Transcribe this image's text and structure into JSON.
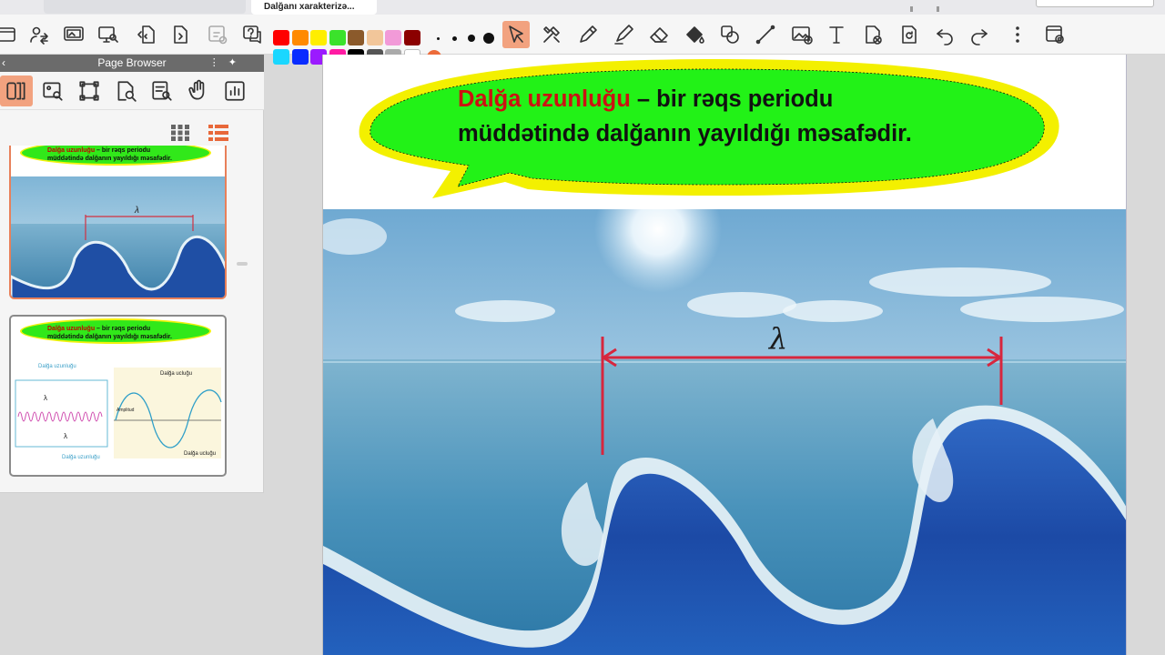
{
  "tabs": {
    "active_label": "Dalğanı xarakterizə..."
  },
  "toolbar": {
    "colors": {
      "row1": [
        "#ff0000",
        "#ff8a00",
        "#ffee00",
        "#3be22b",
        "#8b5a2b",
        "#f2c69a",
        "#f29ad8",
        "#8b0000"
      ],
      "row2": [
        "#1ad7ff",
        "#0a2cff",
        "#9b1aff",
        "#ff1aa3",
        "#000000",
        "#555555",
        "#aaaaaa",
        "#ffffff"
      ]
    },
    "selected_tool": "select-arrow"
  },
  "page_browser": {
    "title": "Page Browser",
    "view_modes": [
      "grid-view-icon",
      "list-view-icon"
    ],
    "selected_view": "list-view-icon",
    "thumbnails": [
      {
        "heading_term": "Dalğa uzunluğu",
        "heading_rest": " – bir rəqs periodu",
        "line2": "müddətində dalğanın yayıldığı məsafədir.",
        "lambda": "λ"
      },
      {
        "heading_term": "Dalğa uzunluğu",
        "heading_rest": " – bir rəqs periodu",
        "line2": "müddətində dalğanın yayıldığı məsafədir.",
        "diagram_labels": {
          "top_left": "Dalğa uzunluğu",
          "lambda_a": "λ",
          "lambda_b": "λ",
          "bottom_left": "Dalğa uzunluğu",
          "top_right": "Dalğa ucluğu",
          "amplitude": "Amplitud",
          "bottom_right": "Dalğa ucluğu"
        }
      }
    ]
  },
  "document": {
    "definition_term": "Dalğa uzunluğu",
    "definition_rest_line1": " – bir rəqs periodu",
    "definition_line2": "müddətində dalğanın yayıldığı məsafədir.",
    "lambda_symbol": "λ"
  }
}
